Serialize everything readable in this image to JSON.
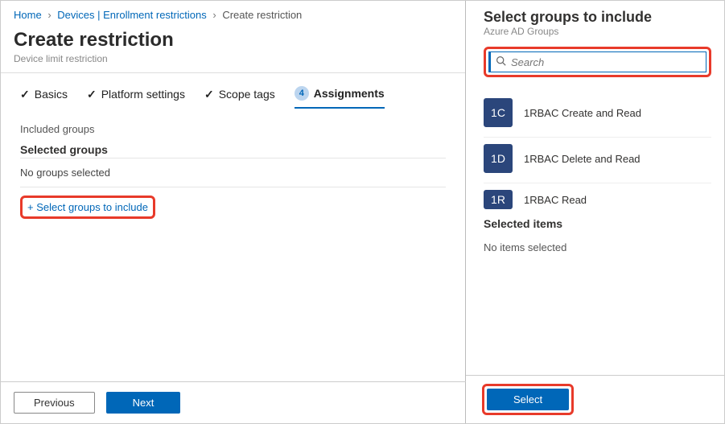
{
  "breadcrumb": {
    "home": "Home",
    "devices": "Devices | Enrollment restrictions",
    "current": "Create restriction"
  },
  "header": {
    "title": "Create restriction",
    "subtitle": "Device limit restriction"
  },
  "tabs": {
    "basics": "Basics",
    "platform": "Platform settings",
    "scope": "Scope tags",
    "assign_num": "4",
    "assignments": "Assignments"
  },
  "included": {
    "heading": "Included groups",
    "selected_heading": "Selected groups",
    "none_text": "No groups selected",
    "add_link": "+ Select groups to include"
  },
  "footer": {
    "previous": "Previous",
    "next": "Next"
  },
  "panel": {
    "title": "Select groups to include",
    "subtitle": "Azure AD Groups",
    "search_placeholder": "Search",
    "groups": [
      {
        "initials": "1C",
        "name": "1RBAC Create and Read"
      },
      {
        "initials": "1D",
        "name": "1RBAC Delete and Read"
      },
      {
        "initials": "1R",
        "name": "1RBAC Read"
      }
    ],
    "selected_heading": "Selected items",
    "none_selected": "No items selected",
    "select_button": "Select"
  }
}
